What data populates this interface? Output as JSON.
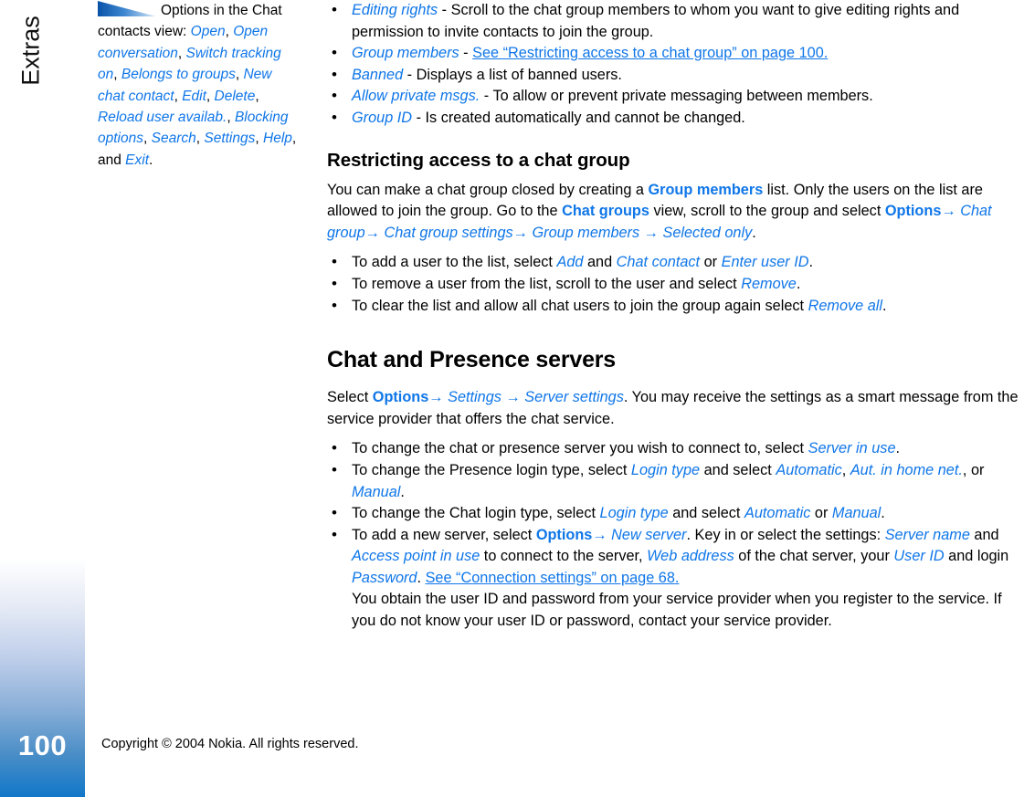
{
  "document": {
    "chapter_tab": "Extras",
    "page_number": "100",
    "copyright": "Copyright © 2004 Nokia. All rights reserved.",
    "link_color": "#0f76e8",
    "bar_color": "#1177c8"
  },
  "side_note": {
    "icon": "tip-triangle-icon",
    "intro": "Options in the Chat contacts view: ",
    "terms": [
      "Open",
      "Open conversation",
      "Switch tracking on",
      "Belongs to groups",
      "New chat contact",
      "Edit",
      "Delete",
      "Reload user availab.",
      "Blocking options",
      "Search",
      "Settings",
      "Help"
    ],
    "conjunction": ", and ",
    "last_term": "Exit",
    "period": "."
  },
  "top_bullets": [
    {
      "term": "Editing rights",
      "dash": " - ",
      "text": "Scroll to the chat group members to whom you want to give editing rights and permission to invite contacts to join the group."
    },
    {
      "term": "Group members",
      "dash": " - ",
      "xref": "See “Restricting access to a chat group” on page 100."
    },
    {
      "term": "Banned",
      "dash": " - ",
      "text": "Displays a list of banned users."
    },
    {
      "term": "Allow private msgs.",
      "dash": " - ",
      "text": "To allow or prevent private messaging between members."
    },
    {
      "term": "Group ID",
      "dash": " - ",
      "text": "Is created automatically and cannot be changed."
    }
  ],
  "section_restricting": {
    "heading": "Restricting access to a chat group",
    "para": {
      "p1": "You can make a chat group closed by creating a ",
      "t1": "Group members",
      "p2": " list. Only the users on the list are allowed to join the group. Go to the ",
      "t2": "Chat groups",
      "p3": " view, scroll to the group and select ",
      "nav": [
        "Options",
        "Chat group",
        "Chat group settings",
        "Group members",
        "Selected only"
      ],
      "p4": "."
    },
    "bullets": [
      {
        "pre": "To add a user to the list, select ",
        "t1": "Add",
        "mid": " and ",
        "t2": "Chat contact",
        "mid2": " or ",
        "t3": "Enter user ID",
        "post": "."
      },
      {
        "pre": "To remove a user from the list, scroll to the user and select ",
        "t1": "Remove",
        "post": "."
      },
      {
        "pre": "To clear the list and allow all chat users to join the group again select ",
        "t1": "Remove all",
        "post": "."
      }
    ]
  },
  "section_servers": {
    "heading": "Chat and Presence servers",
    "para": {
      "p1": "Select ",
      "nav": [
        "Options",
        "Settings",
        "Server settings"
      ],
      "p2": ". You may receive the settings as a smart message from the service provider that offers the chat service."
    },
    "bullets": [
      {
        "pre": "To change the chat or presence server you wish to connect to, select ",
        "t1": "Server in use",
        "post": "."
      },
      {
        "pre": "To change the Presence login type, select ",
        "t1": "Login type",
        "mid": " and select ",
        "t2": "Automatic",
        "mid2": ", ",
        "t3": "Aut. in home net.",
        "mid3": ", or ",
        "t4": "Manual",
        "post": "."
      },
      {
        "pre": "To change the Chat login type, select ",
        "t1": "Login type",
        "mid": " and select ",
        "t2": "Automatic",
        "mid2": " or ",
        "t3": "Manual",
        "post": "."
      },
      {
        "pre": "To add a new server, select ",
        "b1": "Options",
        "arrow": "→ ",
        "t1": "New server",
        "mid": ". Key in or select the settings: ",
        "t2": "Server name",
        "mid2": " and ",
        "t3": "Access point in use",
        "mid3": " to connect to the server, ",
        "t4": "Web address",
        "mid4": " of the chat server, your ",
        "t5": "User ID",
        "mid5": " and login ",
        "t6": "Password",
        "mid6": ". ",
        "xref": "See “Connection settings” on page 68.",
        "tail": "You obtain the user ID and password from your service provider when you register to the service. If you do not know your user ID or password, contact your service provider."
      }
    ]
  }
}
